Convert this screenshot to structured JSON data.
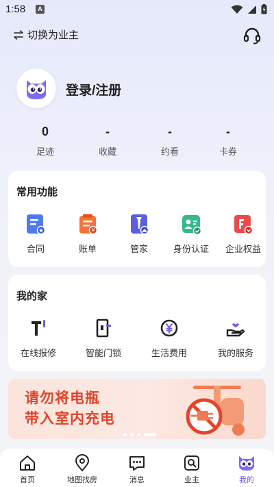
{
  "status_bar": {
    "time": "1:58",
    "notif_letter": "A"
  },
  "header": {
    "switch_label": "切换为业主"
  },
  "profile": {
    "login_label": "登录/注册"
  },
  "stats": [
    {
      "value": "0",
      "label": "足迹"
    },
    {
      "value": "-",
      "label": "收藏"
    },
    {
      "value": "-",
      "label": "约看"
    },
    {
      "value": "-",
      "label": "卡券"
    }
  ],
  "common_functions": {
    "title": "常用功能",
    "items": [
      {
        "label": "合同",
        "icon": "contract-icon"
      },
      {
        "label": "账单",
        "icon": "bill-icon"
      },
      {
        "label": "管家",
        "icon": "butler-icon"
      },
      {
        "label": "身份认证",
        "icon": "id-verify-icon"
      },
      {
        "label": "企业权益",
        "icon": "enterprise-benefits-icon"
      }
    ]
  },
  "my_home": {
    "title": "我的家",
    "items": [
      {
        "label": "在线报修",
        "icon": "repair-icon"
      },
      {
        "label": "智能门锁",
        "icon": "smart-lock-icon"
      },
      {
        "label": "生活费用",
        "icon": "living-expenses-icon"
      },
      {
        "label": "我的服务",
        "icon": "my-service-icon"
      }
    ]
  },
  "banner": {
    "line1": "请勿将电瓶",
    "line2": "带入室内充电"
  },
  "tabbar": [
    {
      "label": "首页",
      "icon": "home-icon"
    },
    {
      "label": "地图找房",
      "icon": "map-pin-icon"
    },
    {
      "label": "消息",
      "icon": "message-icon"
    },
    {
      "label": "业主",
      "icon": "owner-icon"
    },
    {
      "label": "我的",
      "icon": "mine-owl-icon",
      "active": true
    }
  ],
  "colors": {
    "accent": "#6c5ce7",
    "banner_text": "#e0452b"
  }
}
